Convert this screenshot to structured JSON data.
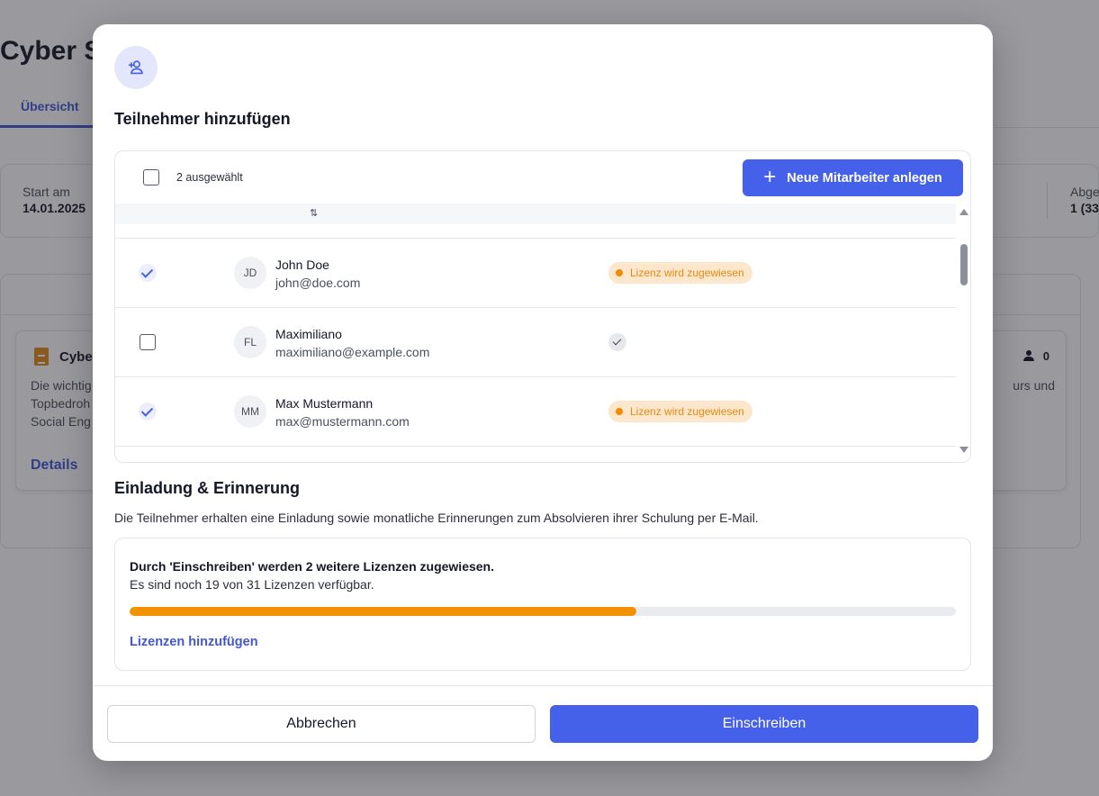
{
  "background": {
    "title": "Cyber S",
    "active_tab": "Übersicht",
    "stats": {
      "start_label": "Start am",
      "start_value": "14.01.2025",
      "right_label": "Abge",
      "right_value": "1 (33"
    },
    "course_card": {
      "title": "Cybe",
      "text_line_1": "Die wichtig",
      "text_line_2": "Topbedroh",
      "text_line_3": "Social Eng",
      "text_right": "urs und",
      "details_link": "Details",
      "participant_count": "0"
    }
  },
  "modal": {
    "title": "Teilnehmer hinzufügen",
    "icon": "add-person-icon",
    "selected_count": "2 ausgewählt",
    "new_button_label": "Neue Mitarbeiter anlegen",
    "sort_icon": "sort-icon",
    "rows": [
      {
        "initials": "JD",
        "name": "John Doe",
        "email": "john@doe.com",
        "selected": true,
        "status": "Lizenz wird zugewiesen"
      },
      {
        "initials": "FL",
        "name": "Maximiliano",
        "email": "maximiliano@example.com",
        "selected": false,
        "status": ""
      },
      {
        "initials": "MM",
        "name": "Max Mustermann",
        "email": "max@mustermann.com",
        "selected": true,
        "status": "Lizenz wird zugewiesen"
      }
    ],
    "invitation": {
      "title": "Einladung & Erinnerung",
      "text": "Die Teilnehmer erhalten eine Einladung sowie monatliche Erinnerungen zum Absolvieren ihrer Schulung per E-Mail."
    },
    "license": {
      "bold_text": "Durch 'Einschreiben' werden 2 weitere Lizenzen zugewiesen.",
      "text": "Es sind noch 19 von 31 Lizenzen verfügbar.",
      "progress_fraction": 0.613,
      "link": "Lizenzen hinzufügen"
    },
    "footer": {
      "cancel_label": "Abbrechen",
      "enroll_label": "Einschreiben"
    }
  },
  "colors": {
    "accent": "#4561e9",
    "warning": "#f39200",
    "badge_bg": "#fde7cc"
  }
}
